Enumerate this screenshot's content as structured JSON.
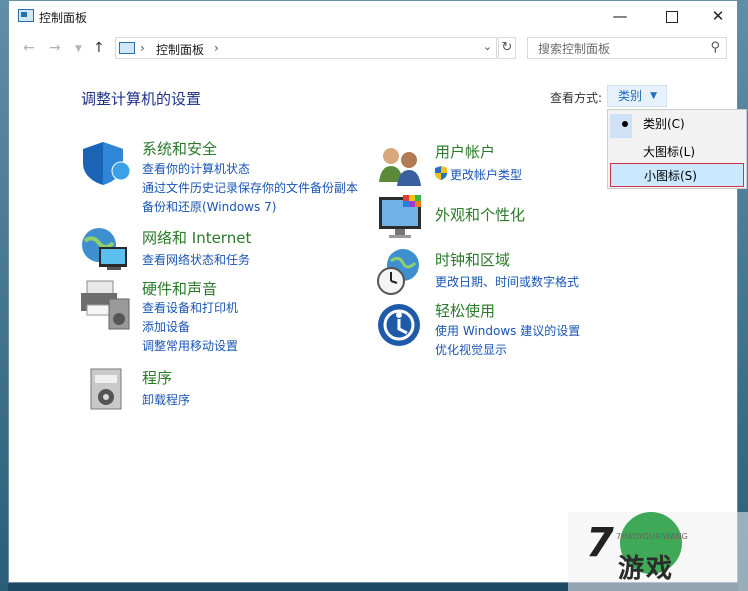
{
  "window": {
    "title": "控制面板"
  },
  "navbar": {
    "address_root": "控制面板",
    "search_placeholder": "搜索控制面板"
  },
  "main": {
    "heading": "调整计算机的设置",
    "view_by_label": "查看方式:",
    "view_by_value": "类别",
    "view_menu": [
      {
        "label": "类别(C)",
        "selected": true
      },
      {
        "label": "大图标(L)",
        "selected": false
      },
      {
        "label": "小图标(S)",
        "selected": false,
        "highlighted": true
      }
    ]
  },
  "categories": {
    "system": {
      "title": "系统和安全",
      "links": [
        "查看你的计算机状态",
        "通过文件历史记录保存你的文件备份副本",
        "备份和还原(Windows 7)"
      ]
    },
    "network": {
      "title": "网络和 Internet",
      "links": [
        "查看网络状态和任务"
      ]
    },
    "hardware": {
      "title": "硬件和声音",
      "links": [
        "查看设备和打印机",
        "添加设备",
        "调整常用移动设置"
      ]
    },
    "programs": {
      "title": "程序",
      "links": [
        "卸载程序"
      ]
    },
    "users": {
      "title": "用户帐户",
      "links": [
        "更改帐户类型"
      ]
    },
    "appearance": {
      "title": "外观和个性化",
      "links": []
    },
    "clock": {
      "title": "时钟和区域",
      "links": [
        "更改日期、时间或数字格式"
      ]
    },
    "ease": {
      "title": "轻松使用",
      "links": [
        "使用 Windows 建议的设置",
        "优化视觉显示"
      ]
    }
  },
  "watermark": {
    "text": "游戏",
    "sub": "7HAOYOUXIWANG"
  },
  "colors": {
    "accent": "#1a55b5",
    "category_title": "#2a7a2a",
    "heading": "#1e3287"
  }
}
